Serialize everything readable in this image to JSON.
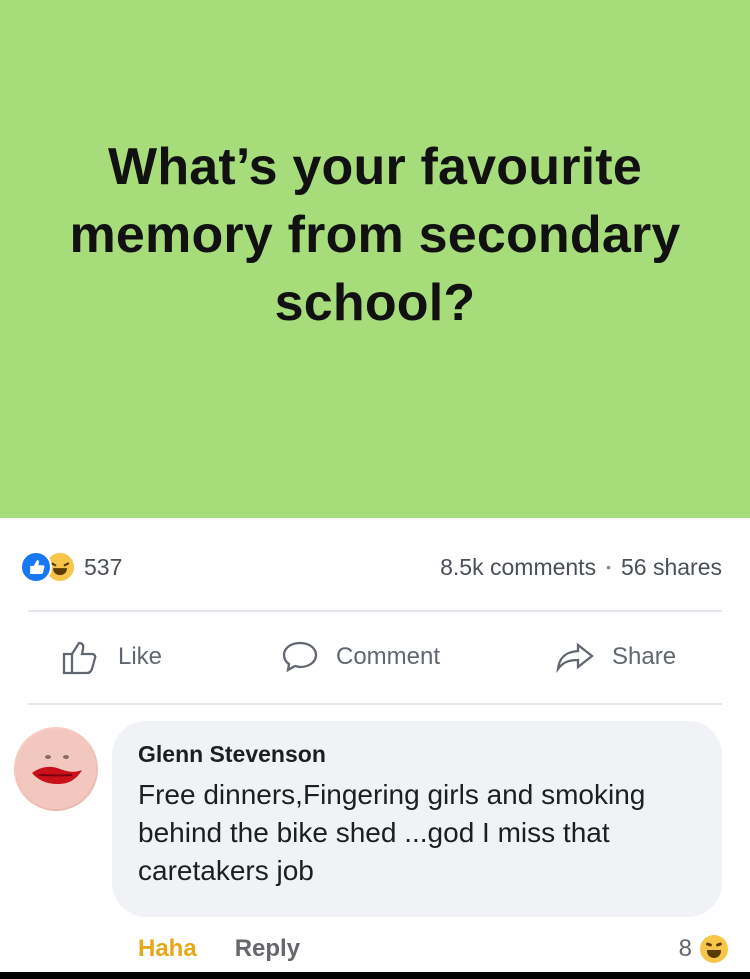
{
  "post": {
    "question": "What’s your favourite memory from secondary school?"
  },
  "stats": {
    "reaction_count": "537",
    "comments": "8.5k comments",
    "separator": "•",
    "shares": "56 shares",
    "reaction_icons": [
      "like-icon",
      "haha-icon"
    ]
  },
  "actions": {
    "like": "Like",
    "comment": "Comment",
    "share": "Share"
  },
  "comment": {
    "author": "Glenn Stevenson",
    "text": "Free dinners,Fingering girls and smoking behind the bike shed ...god I miss that caretakers job",
    "haha_label": "Haha",
    "reply_label": "Reply",
    "reaction_count": "8"
  },
  "colors": {
    "banner": "#a7dc7a",
    "like_blue": "#1877f2",
    "haha_yellow": "#f7c54a"
  }
}
